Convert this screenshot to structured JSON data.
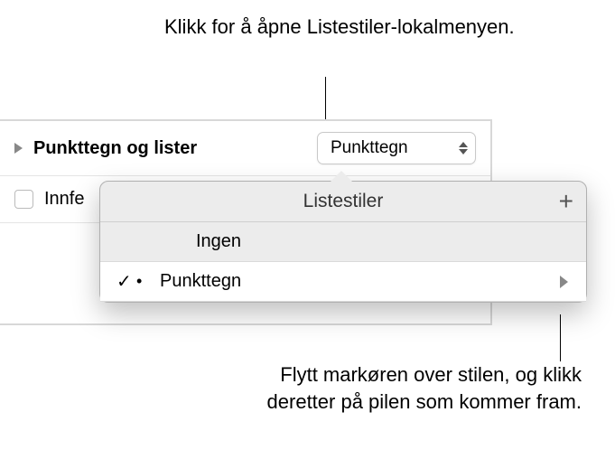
{
  "callouts": {
    "top": "Klikk for å åpne Listestiler-lokalmenyen.",
    "bottom": "Flytt markøren over stilen, og klikk deretter på pilen som kommer fram."
  },
  "panel": {
    "section_label": "Punkttegn og lister",
    "dropdown_value": "Punkttegn",
    "sub_label": "Innfe"
  },
  "popover": {
    "title": "Listestiler",
    "plus": "+",
    "items": [
      {
        "name": "Ingen",
        "selected": false
      },
      {
        "name": "Punkttegn",
        "selected": true
      }
    ],
    "checkmark": "✓",
    "bullet": "•"
  }
}
